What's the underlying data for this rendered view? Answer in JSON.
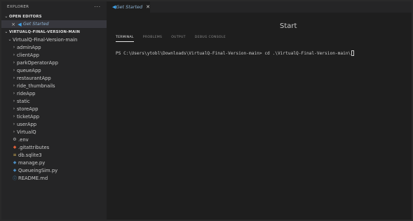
{
  "sidebar": {
    "title": "EXPLORER",
    "more": "···",
    "open_editors": {
      "header": "OPEN EDITORS",
      "items": [
        {
          "label": "Get Started"
        }
      ]
    },
    "project": {
      "header": "VIRTUALQ-FINAL-VERSION-MAIN",
      "root": "VirtualQ-Final-Version-main",
      "folders": [
        "adminApp",
        "clientApp",
        "parkOperatorApp",
        "queueApp",
        "restaurantApp",
        "ride_thumbnails",
        "rideApp",
        "static",
        "storeApp",
        "ticketApp",
        "userApp",
        "VirtualQ"
      ],
      "files": [
        {
          "label": ".env",
          "icon": "gear-icon",
          "glyph": "⚙",
          "color": "#b8b8b8"
        },
        {
          "label": ".gitattributes",
          "icon": "git-icon",
          "glyph": "◆",
          "color": "#e0603a"
        },
        {
          "label": "db.sqlite3",
          "icon": "database-icon",
          "glyph": "≡",
          "color": "#d8b254"
        },
        {
          "label": "manage.py",
          "icon": "python-icon",
          "glyph": "◆",
          "color": "#4b8bbe"
        },
        {
          "label": "QueueingSim.py",
          "icon": "python-icon",
          "glyph": "◆",
          "color": "#4b8bbe"
        },
        {
          "label": "README.md",
          "icon": "info-icon",
          "glyph": "ⓘ",
          "color": "#4a9ed8"
        }
      ]
    }
  },
  "tabs": [
    {
      "label": "Get Started",
      "close": "✕"
    }
  ],
  "editor": {
    "start_heading": "Start"
  },
  "panel": {
    "tabs": [
      "TERMINAL",
      "PROBLEMS",
      "OUTPUT",
      "DEBUG CONSOLE"
    ],
    "active_tab": "TERMINAL",
    "terminal_line": "PS C:\\Users\\ytobl\\Downloads\\VirtualQ-Final-Version-main> cd .\\VirtualQ-Final-Version-main\\"
  },
  "colors": {
    "accent": "#3ea2ea",
    "sidebar_bg": "#252526",
    "editor_bg": "#1e1e1e"
  }
}
